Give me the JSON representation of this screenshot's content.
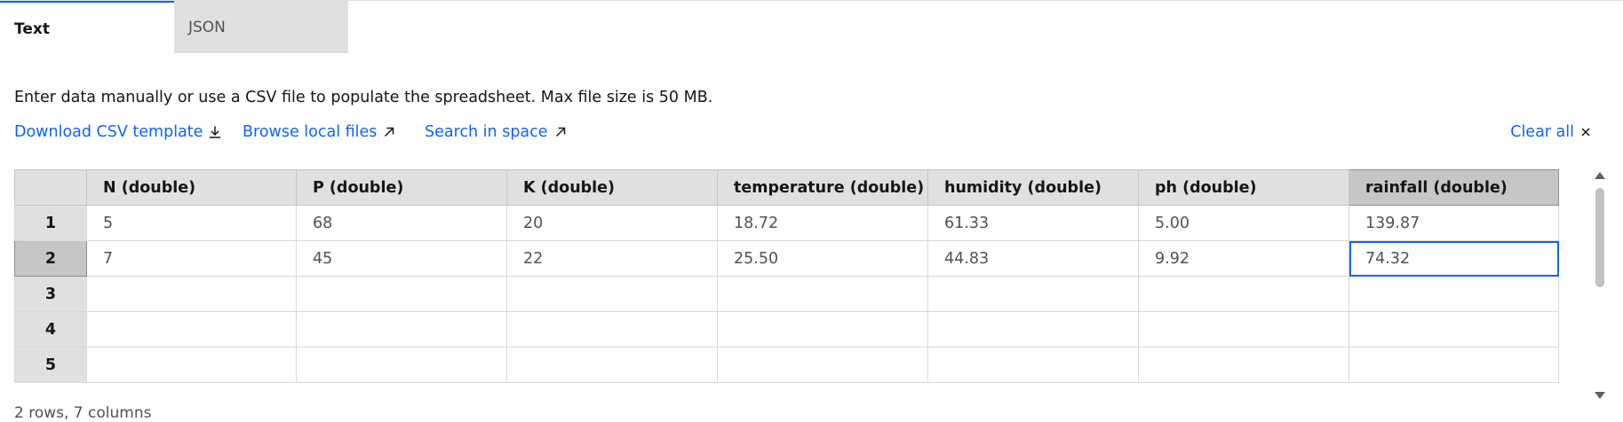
{
  "tabs": [
    {
      "label": "Text",
      "selected": true
    },
    {
      "label": "JSON",
      "selected": false
    }
  ],
  "description": "Enter data manually or use a CSV file to populate the spreadsheet. Max file size is 50 MB.",
  "links": {
    "download": {
      "label": "Download CSV template",
      "icon": "download-icon"
    },
    "browse": {
      "label": "Browse local files",
      "icon": "arrow-up-right-icon"
    },
    "search": {
      "label": "Search in space",
      "icon": "arrow-up-right-icon"
    },
    "clear": {
      "label": "Clear all",
      "icon": "close-icon"
    }
  },
  "table": {
    "columns": [
      "N (double)",
      "P (double)",
      "K (double)",
      "temperature (double)",
      "humidity (double)",
      "ph (double)",
      "rainfall (double)"
    ],
    "selected_column": "rainfall (double)",
    "rows": [
      {
        "num": "1",
        "cells": [
          "5",
          "68",
          "20",
          "18.72",
          "61.33",
          "5.00",
          "139.87"
        ]
      },
      {
        "num": "2",
        "cells": [
          "7",
          "45",
          "22",
          "25.50",
          "44.83",
          "9.92",
          "74.32"
        ]
      },
      {
        "num": "3",
        "cells": [
          "",
          "",
          "",
          "",
          "",
          "",
          ""
        ]
      },
      {
        "num": "4",
        "cells": [
          "",
          "",
          "",
          "",
          "",
          "",
          ""
        ]
      },
      {
        "num": "5",
        "cells": [
          "",
          "",
          "",
          "",
          "",
          "",
          ""
        ]
      }
    ],
    "selected_row": "2",
    "active_cell": {
      "row": "2",
      "column": "rainfall (double)",
      "value": "74.32"
    }
  },
  "footer": "2 rows, 7 columns",
  "colors": {
    "accent": "#0f62fe",
    "header_bg": "#e0e0e0",
    "selected_bg": "#c6c6c6"
  }
}
